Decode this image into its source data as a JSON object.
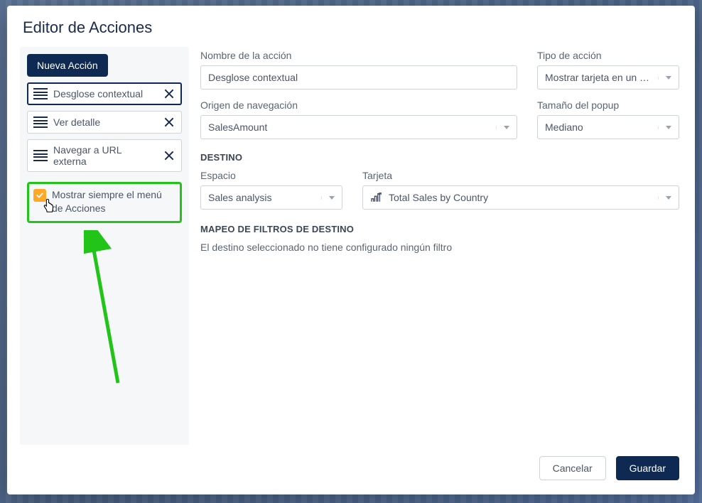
{
  "modal": {
    "title": "Editor de Acciones"
  },
  "sidebar": {
    "newActionLabel": "Nueva Acción",
    "items": [
      {
        "label": "Desglose contextual"
      },
      {
        "label": "Ver detalle"
      },
      {
        "label": "Navegar a URL externa"
      }
    ],
    "checkboxLabel": "Mostrar siempre el menú de Acciones",
    "checkboxChecked": true
  },
  "form": {
    "name": {
      "label": "Nombre de la acción",
      "value": "Desglose contextual"
    },
    "type": {
      "label": "Tipo de acción",
      "value": "Mostrar tarjeta en un …"
    },
    "navOrigin": {
      "label": "Origen de navegación",
      "value": "SalesAmount"
    },
    "popupSize": {
      "label": "Tamaño del popup",
      "value": "Mediano"
    },
    "destinationHead": "DESTINO",
    "space": {
      "label": "Espacio",
      "value": "Sales analysis"
    },
    "card": {
      "label": "Tarjeta",
      "value": "Total Sales by Country"
    },
    "filterHead": "MAPEO DE FILTROS DE DESTINO",
    "filterNote": "El destino seleccionado no tiene configurado ningún filtro"
  },
  "footer": {
    "cancel": "Cancelar",
    "save": "Guardar"
  },
  "colors": {
    "accent": "#0f2a52",
    "highlight": "#22c41a",
    "checkbox": "#ffa826"
  }
}
